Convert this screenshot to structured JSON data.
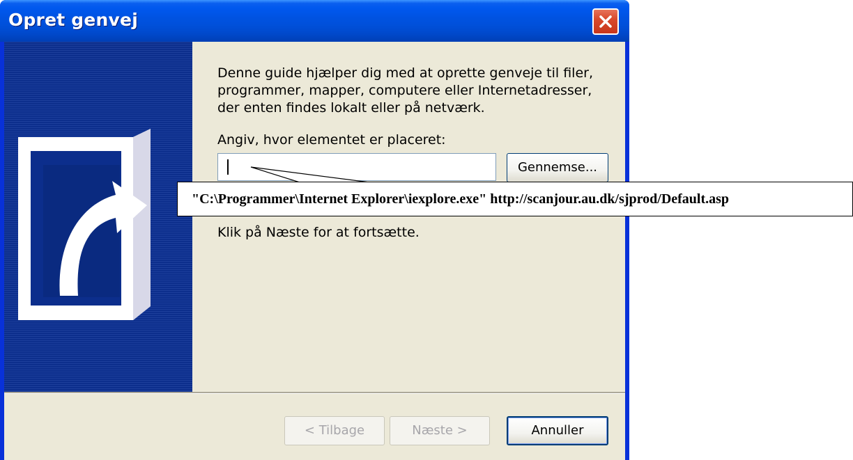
{
  "window": {
    "title": "Opret genvej"
  },
  "icons": {
    "close": "close-icon",
    "shortcut": "shortcut-arrow-icon"
  },
  "intro": {
    "lines": [
      "Denne guide hjælper dig med at oprette genveje til filer,",
      "programmer, mapper, computere eller Internetadresser,",
      "der enten findes lokalt eller på netværk."
    ]
  },
  "location": {
    "label": "Angiv, hvor elementet er placeret:",
    "value": "",
    "browse_label": "Gennemse..."
  },
  "hint": "Klik på Næste for at fortsætte.",
  "buttons": {
    "back": "< Tilbage",
    "next": "Næste >",
    "cancel": "Annuller"
  },
  "callout": {
    "text": "\"C:\\Programmer\\Internet Explorer\\iexplore.exe\" http://scanjour.au.dk/sjprod/Default.asp"
  },
  "colors": {
    "titlebar": "#0058ee",
    "dialog_bg": "#ece9d8",
    "side_panel": "#0c2e8c",
    "close_button": "#d9492c"
  }
}
